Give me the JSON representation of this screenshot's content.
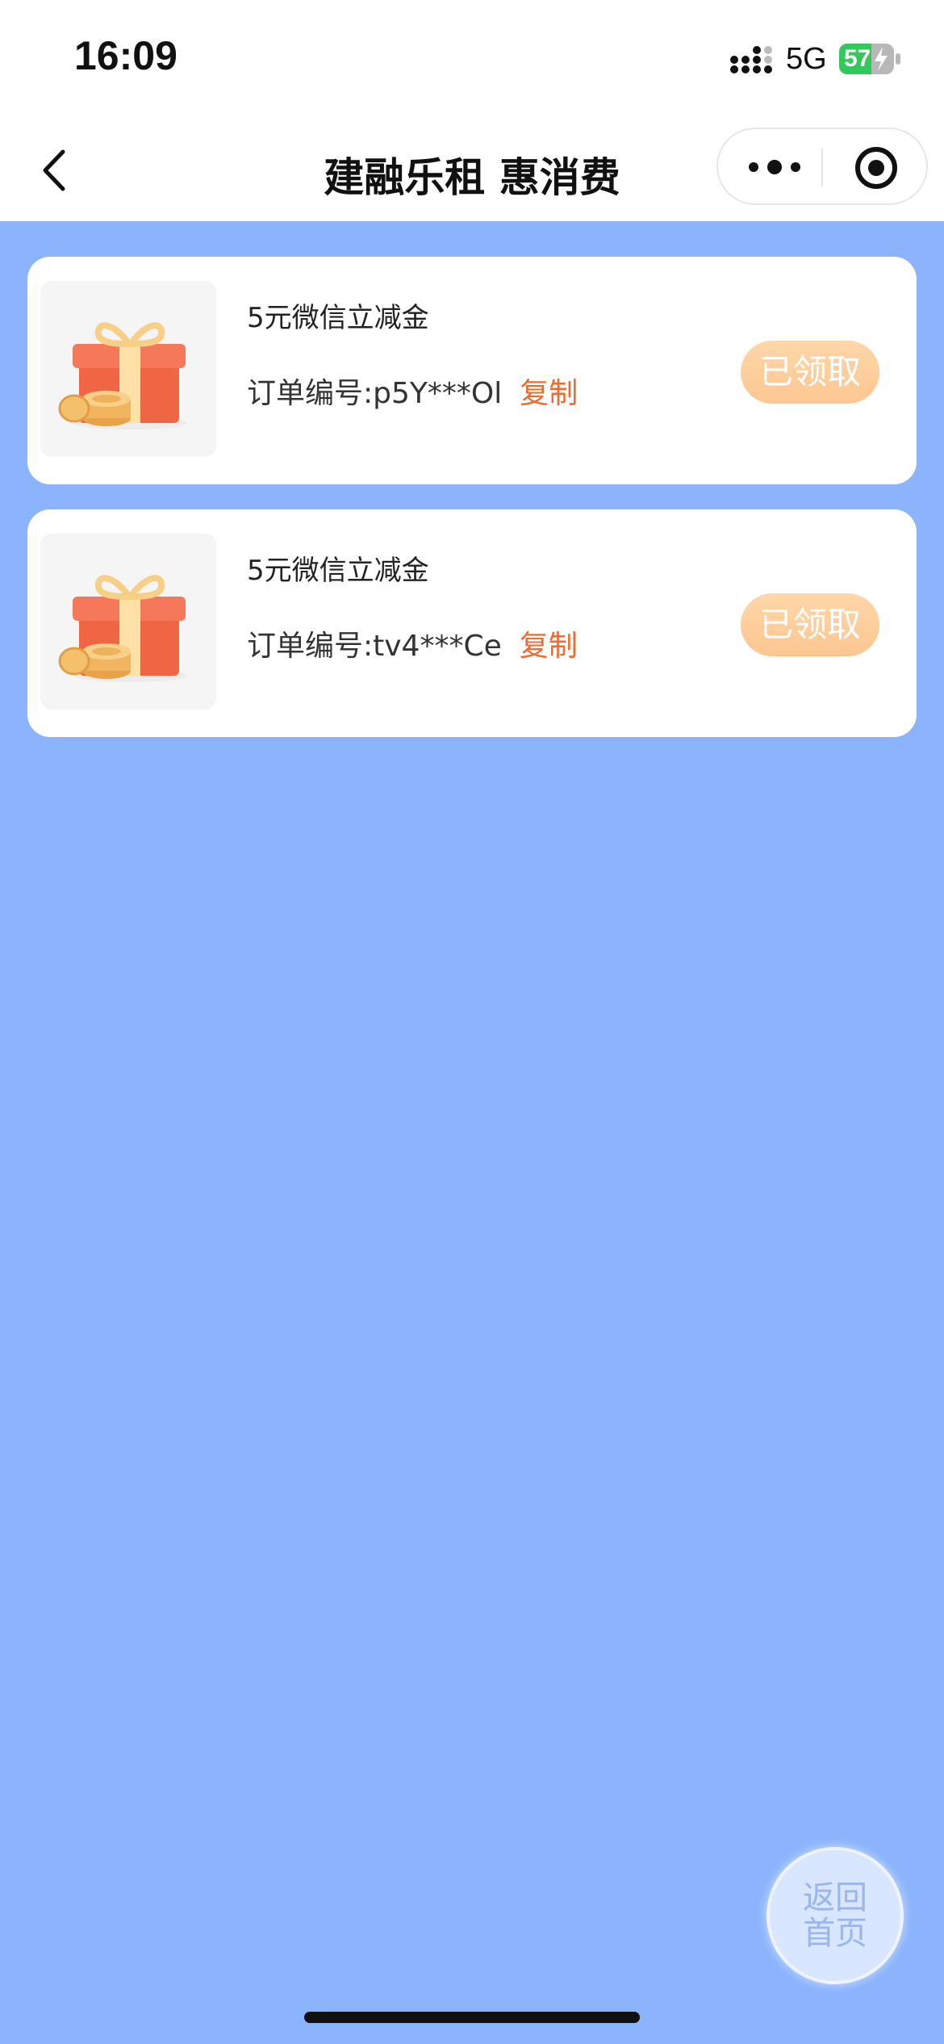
{
  "status_bar": {
    "time": "16:09",
    "network": "5G",
    "battery_level": "57",
    "icons": [
      "signal-icon",
      "battery-charging-icon"
    ]
  },
  "nav": {
    "title": "建融乐租 惠消费",
    "icons": [
      "back-arrow-icon",
      "more-dots-icon",
      "close-target-icon"
    ]
  },
  "coupons": [
    {
      "title": "5元微信立减金",
      "order_label": "订单编号:",
      "order_number": "p5Y***Ol",
      "copy_label": "复制",
      "status_label": "已领取",
      "icon": "gift-box-icon"
    },
    {
      "title": "5元微信立减金",
      "order_label": "订单编号:",
      "order_number": "tv4***Ce",
      "copy_label": "复制",
      "status_label": "已领取",
      "icon": "gift-box-icon"
    }
  ],
  "home_button": {
    "label": "返回首页"
  },
  "colors": {
    "background": "#8bb4fd",
    "copy_link": "#ee6b2f",
    "claimed_button": "#fbbd7e",
    "battery": "#34c759"
  }
}
